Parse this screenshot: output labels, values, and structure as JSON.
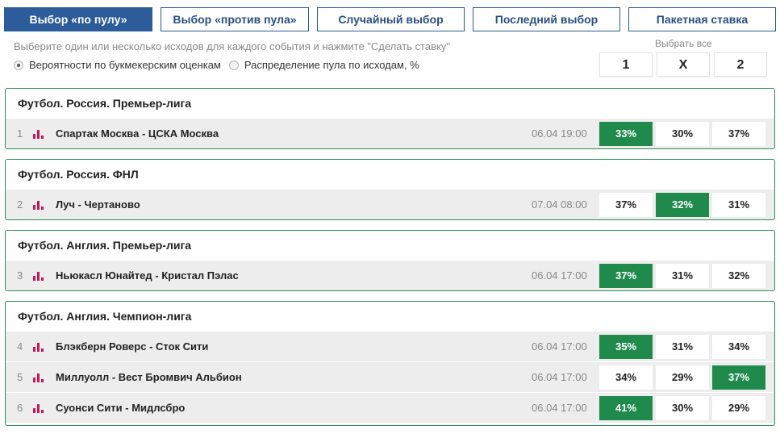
{
  "tabs": [
    {
      "label": "Выбор «по пулу»",
      "active": true
    },
    {
      "label": "Выбор «против пула»",
      "active": false
    },
    {
      "label": "Случайный выбор",
      "active": false
    },
    {
      "label": "Последний выбор",
      "active": false
    },
    {
      "label": "Пакетная ставка",
      "active": false
    }
  ],
  "hint": "Выберите один или несколько исходов для каждого события и нажмите \"Сделать ставку\"",
  "radios": [
    {
      "label": "Вероятности по букмекерским оценкам",
      "checked": true
    },
    {
      "label": "Распределение пула по исходам, %",
      "checked": false
    }
  ],
  "select_all": {
    "label": "Выбрать все",
    "buttons": [
      "1",
      "X",
      "2"
    ]
  },
  "leagues": [
    {
      "title": "Футбол. Россия. Премьер-лига",
      "events": [
        {
          "num": "1",
          "name": "Спартак Москва - ЦСКА Москва",
          "date": "06.04 19:00",
          "odds": [
            "33%",
            "30%",
            "37%"
          ],
          "selected": 0
        }
      ]
    },
    {
      "title": "Футбол. Россия. ФНЛ",
      "events": [
        {
          "num": "2",
          "name": "Луч - Чертаново",
          "date": "07.04 08:00",
          "odds": [
            "37%",
            "32%",
            "31%"
          ],
          "selected": 1
        }
      ]
    },
    {
      "title": "Футбол. Англия. Премьер-лига",
      "events": [
        {
          "num": "3",
          "name": "Ньюкасл Юнайтед - Кристал Пэлас",
          "date": "06.04 17:00",
          "odds": [
            "37%",
            "31%",
            "32%"
          ],
          "selected": 0
        }
      ]
    },
    {
      "title": "Футбол. Англия. Чемпион-лига",
      "events": [
        {
          "num": "4",
          "name": "Блэкберн Роверс - Сток Сити",
          "date": "06.04 17:00",
          "odds": [
            "35%",
            "31%",
            "34%"
          ],
          "selected": 0
        },
        {
          "num": "5",
          "name": "Миллуолл - Вест Бромвич Альбион",
          "date": "06.04 17:00",
          "odds": [
            "34%",
            "29%",
            "37%"
          ],
          "selected": 2
        },
        {
          "num": "6",
          "name": "Суонси Сити - Мидлсбро",
          "date": "06.04 17:00",
          "odds": [
            "41%",
            "30%",
            "29%"
          ],
          "selected": 0
        }
      ]
    }
  ],
  "colors": {
    "accent": "#2c5c9a",
    "selected": "#1f8a4c",
    "stat_icon": "#c2185b"
  },
  "icons": {
    "stat": "bar-chart-icon"
  }
}
